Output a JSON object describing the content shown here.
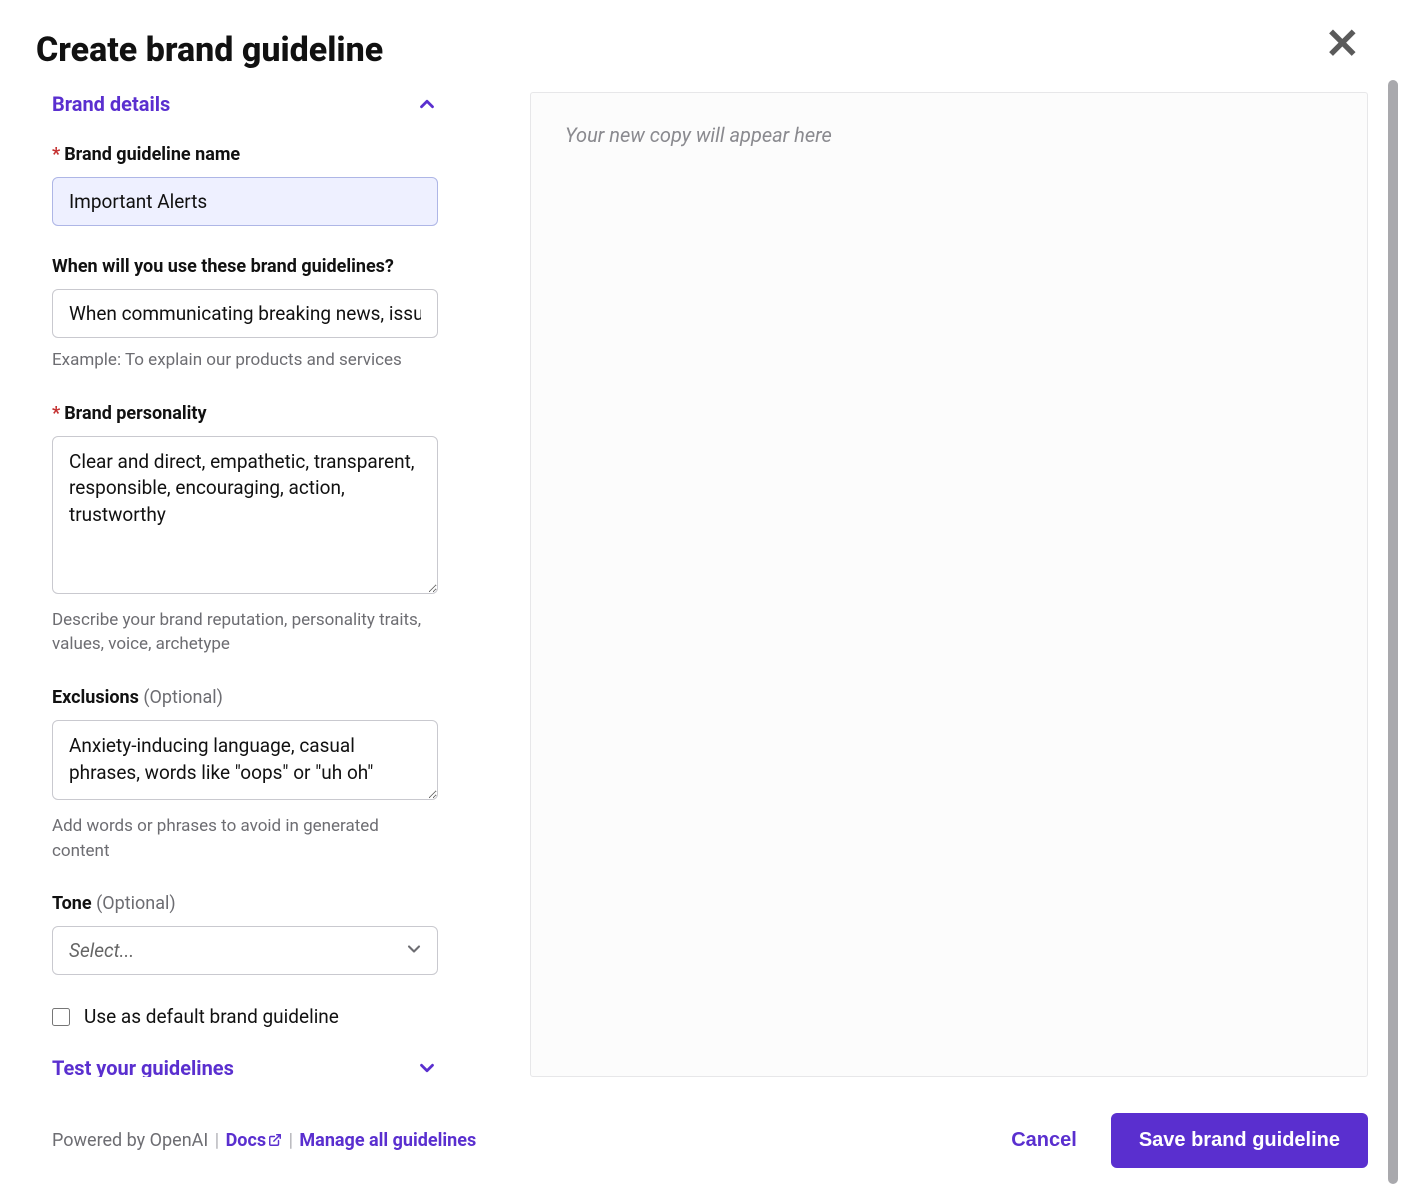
{
  "title": "Create brand guideline",
  "close_label": "Close",
  "sections": {
    "brand_details": {
      "label": "Brand details",
      "expanded": true
    },
    "test": {
      "label": "Test your guidelines",
      "expanded": false
    }
  },
  "fields": {
    "name": {
      "label": "Brand guideline name",
      "required": true,
      "value": "Important Alerts"
    },
    "when": {
      "label": "When will you use these brand guidelines?",
      "required": false,
      "value": "When communicating breaking news, issu",
      "helper": "Example: To explain our products and services"
    },
    "personality": {
      "label": "Brand personality",
      "required": true,
      "value": "Clear and direct, empathetic, transparent, responsible, encouraging, action, trustworthy",
      "helper": "Describe your brand reputation, personality traits, values, voice, archetype"
    },
    "exclusions": {
      "label": "Exclusions",
      "optional_text": "(Optional)",
      "value": "Anxiety-inducing language, casual phrases, words like \"oops\" or \"uh oh\"",
      "helper": "Add words or phrases to avoid in generated content"
    },
    "tone": {
      "label": "Tone",
      "optional_text": "(Optional)",
      "placeholder": "Select..."
    },
    "default": {
      "label": "Use as default brand guideline",
      "checked": false
    }
  },
  "preview": {
    "placeholder": "Your new copy will appear here"
  },
  "footer": {
    "powered": "Powered by OpenAI",
    "docs": "Docs",
    "manage": "Manage all guidelines",
    "cancel": "Cancel",
    "save": "Save brand guideline"
  }
}
